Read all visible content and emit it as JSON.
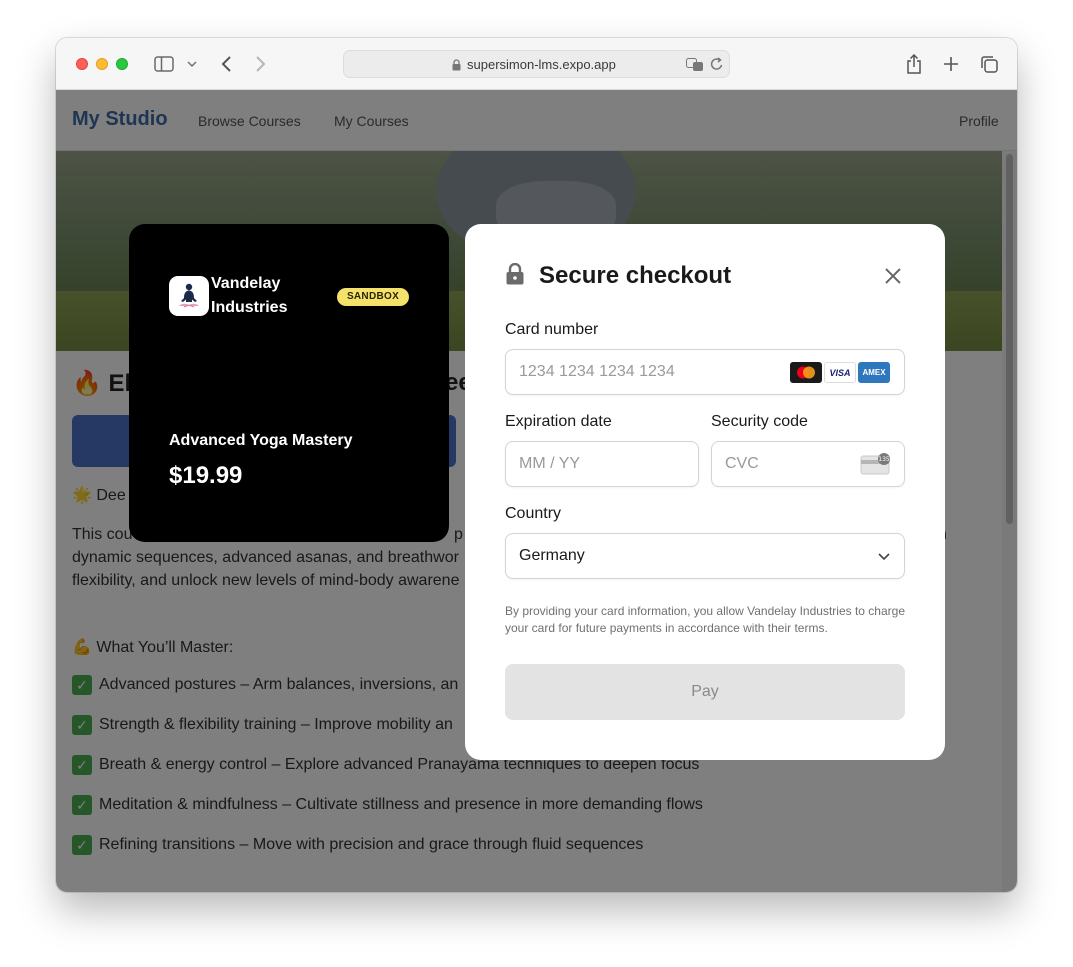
{
  "browser": {
    "url": "supersimon-lms.expo.app"
  },
  "nav": {
    "brand": "My Studio",
    "links": [
      "Browse Courses",
      "My Courses"
    ],
    "profile": "Profile"
  },
  "course": {
    "title_visible": "🔥 Ele",
    "title_tail": "ee",
    "tagline": "🌟 Dee",
    "description_lines": [
      "This cou",
      "dynamic sequences, advanced asanas, and breathwor",
      "flexibility, and unlock new levels of mind-body awarene"
    ],
    "description_right_fragments": [
      "p",
      "n"
    ],
    "master_heading": "💪 What You’ll Master:",
    "features": [
      "Advanced postures – Arm balances, inversions, an",
      "Strength & flexibility training – Improve mobility an",
      "Breath & energy control – Explore advanced Pranayama techniques to deepen focus",
      "Meditation & mindfulness – Cultivate stillness and presence in more demanding flows",
      "Refining transitions – Move with precision and grace through fluid sequences"
    ]
  },
  "product_card": {
    "merchant": "Vandelay Industries",
    "badge": "SANDBOX",
    "product_name": "Advanced Yoga Mastery",
    "price": "$19.99"
  },
  "checkout": {
    "title": "Secure checkout",
    "card_number_label": "Card number",
    "card_number_placeholder": "1234 1234 1234 1234",
    "card_brands": [
      "mastercard",
      "VISA",
      "AMEX"
    ],
    "expiration_label": "Expiration date",
    "expiration_placeholder": "MM / YY",
    "security_label": "Security code",
    "security_placeholder": "CVC",
    "cvc_hint": "135",
    "country_label": "Country",
    "country_value": "Germany",
    "disclaimer": "By providing your card information, you allow Vandelay Industries to charge your card for future payments in accordance with their terms.",
    "pay_label": "Pay"
  },
  "colors": {
    "brand_blue": "#3d6aa8",
    "sandbox_yellow": "#f5e26b",
    "pay_disabled": "#e3e3e3",
    "check_green": "#4caf50"
  }
}
